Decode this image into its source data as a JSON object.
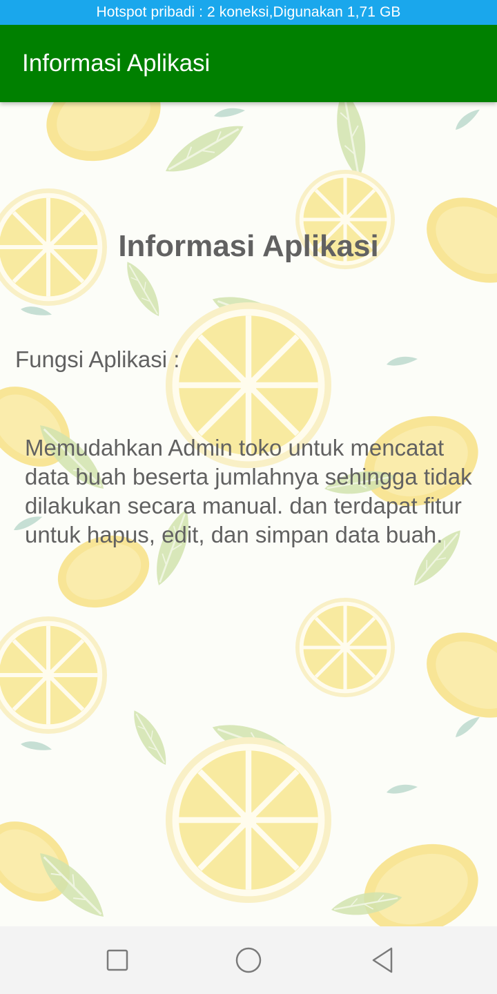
{
  "status_bar": {
    "text": "Hotspot pribadi : 2 koneksi,Digunakan 1,71 GB"
  },
  "app_bar": {
    "title": "Informasi Aplikasi"
  },
  "content": {
    "heading": "Informasi Aplikasi",
    "section_label": "Fungsi Aplikasi :",
    "description": "Memudahkan Admin  toko untuk mencatat data buah beserta jumlahnya sehingga tidak dilakukan secara manual. dan terdapat fitur untuk hapus, edit, dan simpan data buah."
  },
  "nav_bar": {
    "recents_icon": "square-icon",
    "home_icon": "circle-icon",
    "back_icon": "triangle-back-icon"
  },
  "colors": {
    "status_bar": "#1aa7ec",
    "app_bar": "#008000",
    "text": "#616161",
    "nav_bar": "#f3f3f3"
  }
}
